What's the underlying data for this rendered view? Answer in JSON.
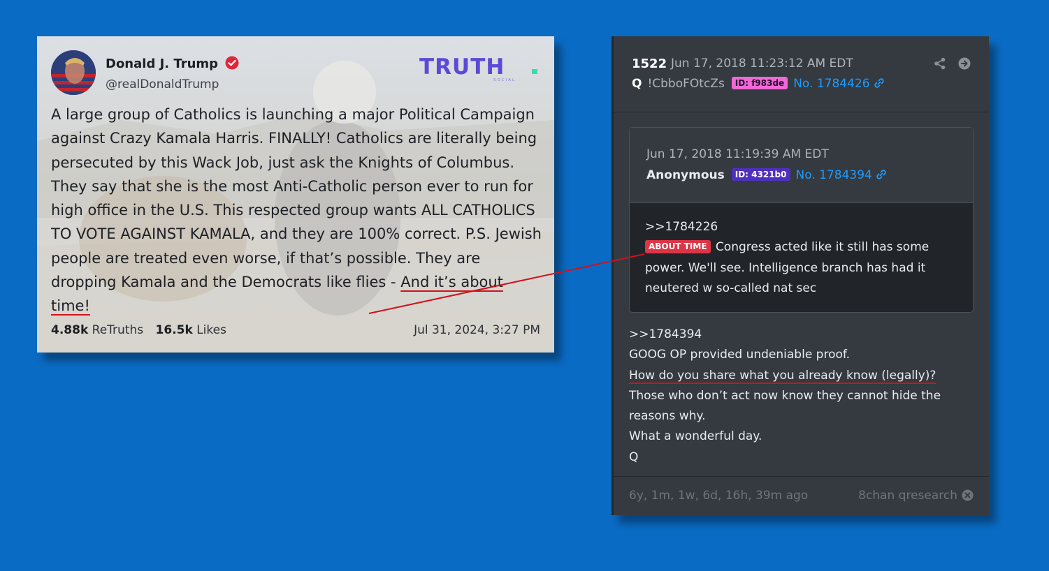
{
  "truth_post": {
    "author_name": "Donald J. Trump",
    "handle": "@realDonaldTrump",
    "logo_text": "TRUTH",
    "logo_subtext": "SOCIAL",
    "text_before": "A large group of Catholics is launching a major Political Campaign against Crazy Kamala Harris. FINALLY! Catholics are literally being persecuted by this Wack Job, just ask the Knights of Columbus. They say that she is the most Anti-Catholic person ever to run for high office in the U.S. This respected group wants ALL CATHOLICS TO VOTE AGAINST KAMALA, and they are 100% correct. P.S. Jewish people are treated even worse, if that’s possible. They are dropping Kamala and the Democrats like flies - ",
    "text_highlight": "And it’s about time!",
    "retruths_count": "4.88k",
    "retruths_label": "ReTruths",
    "likes_count": "16.5k",
    "likes_label": "Likes",
    "date": "Jul 31, 2024, 3:27 PM",
    "verified_color": "#e0263a",
    "logo_color": "#5b4ad6",
    "logo_accent_color": "#2fe0b0"
  },
  "q_post": {
    "number": "1522",
    "timestamp": "Jun 17, 2018 11:23:12 AM EDT",
    "author": "Q",
    "tripcode": "!CbboFOtcZs",
    "id_badge": "ID: f983de",
    "post_link": "No. 1784426",
    "quoted": {
      "timestamp": "Jun 17, 2018 11:19:39 AM EDT",
      "author": "Anonymous",
      "id_badge": "ID: 4321b0",
      "post_link": "No. 1784394",
      "reply_ref": ">>1784226",
      "tag": "ABOUT TIME",
      "text": " Congress acted like it still has some power. We'll see. Intelligence branch has had it neutered w so-called nat sec"
    },
    "body": {
      "line1": ">>1784394",
      "line2": "GOOG OP provided undeniable proof.",
      "line3": "How do you share what you already know (legally)?",
      "line4": "Those who don’t act now know they cannot hide the reasons why.",
      "line5": "What a wonderful day.",
      "line6": "Q"
    },
    "time_ago": "6y, 1m, 1w, 6d, 16h, 39m ago",
    "source": "8chan qresearch",
    "icons": [
      "share-icon",
      "arrow-circle-right-icon",
      "link-icon",
      "close-circle-icon"
    ]
  }
}
